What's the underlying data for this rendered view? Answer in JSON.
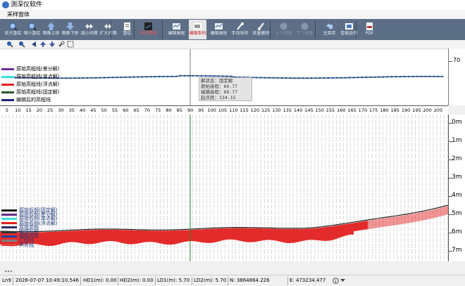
{
  "window": {
    "title": "测深仪软件"
  },
  "menu": {
    "label": "采样窗体"
  },
  "toolbar": [
    {
      "label": "放大重绘",
      "icon": "zoom-in-icon"
    },
    {
      "label": "缩小重绘",
      "icon": "zoom-out-icon"
    },
    {
      "label": "图像上移",
      "icon": "arrow-up-icon"
    },
    {
      "label": "图像下移",
      "icon": "arrow-down-icon"
    },
    {
      "label": "减小间隔",
      "icon": "shrink-interval-icon"
    },
    {
      "label": "扩大间隔",
      "icon": "expand-interval-icon"
    },
    {
      "label": "重绘",
      "icon": "redraw-icon"
    },
    {
      "label": "显示回波",
      "icon": "echo-icon",
      "state": "red"
    },
    {
      "label": "编辑高程",
      "icon": "edit-elevation-icon"
    },
    {
      "label": "编辑条码",
      "icon": "barcode-icon",
      "state": "active"
    },
    {
      "label": "编辑高程",
      "icon": "edit-elevation-icon"
    },
    {
      "label": "手动采样",
      "icon": "manual-sample-icon"
    },
    {
      "label": "批量删除",
      "icon": "batch-delete-icon"
    },
    {
      "label": "上个调查",
      "icon": "previous-icon",
      "state": "dim"
    },
    {
      "label": "下个调查",
      "icon": "next-icon",
      "state": "dim"
    },
    {
      "label": "主菜单",
      "icon": "main-menu-icon"
    },
    {
      "label": "智能处理",
      "icon": "smart-process-icon"
    },
    {
      "label": "PDF",
      "icon": "pdf-icon"
    }
  ],
  "upper_chart": {
    "legend": [
      {
        "label": "原始高程线(差分解)",
        "color": "#7030a0"
      },
      {
        "label": "原始高程线(单点解)",
        "color": "#40e0e0"
      },
      {
        "label": "原始高程线(浮点解)",
        "color": "#e02020"
      },
      {
        "label": "原始高程线(固定解)",
        "color": "#2a5a2a"
      },
      {
        "label": "编辑后的高程线",
        "color": "#1a237e"
      }
    ],
    "right_axis_label": "70",
    "info": {
      "lines": [
        "解状态：固定解",
        "原始高程：69.77",
        "编辑高程：69.77",
        "起点距：134.15"
      ]
    }
  },
  "ruler": {
    "ticks": [
      "5",
      "10",
      "15",
      "20",
      "25",
      "30",
      "35",
      "40",
      "45",
      "50",
      "55",
      "60",
      "65",
      "70",
      "75",
      "80",
      "85",
      "90",
      "95",
      "100",
      "105",
      "110",
      "115",
      "120",
      "125",
      "130",
      "135",
      "140",
      "145",
      "150",
      "155",
      "160",
      "165",
      "170",
      "175",
      "180",
      "185",
      "190",
      "195",
      "200",
      "205"
    ]
  },
  "depth_axis": {
    "labels": [
      "0m",
      "1m",
      "2m",
      "3m",
      "4m",
      "5m",
      "6m",
      "7m"
    ]
  },
  "main_legend": [
    {
      "label": "原始低频(固定解)",
      "color": "#1b1b1b"
    },
    {
      "label": "原始低频(差分解)",
      "color": "#6a2a8a"
    },
    {
      "label": "原始低频(单点解)",
      "color": "#40e0e0"
    },
    {
      "label": "原始低频(浮点解)",
      "color": "#e02020"
    },
    {
      "label": "原始高频",
      "color": "#2a2a6a"
    },
    {
      "label": "编辑低频",
      "color": "#333333"
    },
    {
      "label": "编辑高频",
      "color": "#2040a0"
    },
    {
      "label": "打标线",
      "color": "#808080"
    },
    {
      "label": "声界线",
      "color": "#e04040"
    }
  ],
  "status": {
    "line": "Ln9",
    "time": "2026-07-07 10:49:10.546",
    "hd1": "HD1(m): 0.00",
    "hd2": "HD2(m): 0.00",
    "ld1": "LD1(m): 5.70",
    "ld2": "LD2(m): 5.70",
    "n": "N: 3864864.226",
    "e": "E: 473234.477"
  },
  "colors": {
    "toolbar_bg": "#5d6f86",
    "echo_red": "#e01010",
    "cursor_green": "#2e8b2e"
  }
}
